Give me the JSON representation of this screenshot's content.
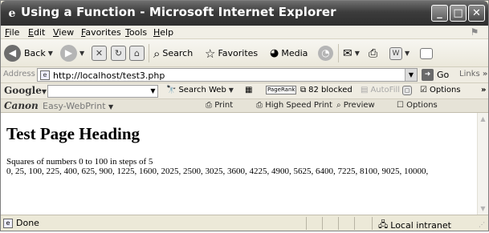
{
  "window": {
    "title": "Using a Function - Microsoft Internet Explorer",
    "controls": {
      "minimize": "_",
      "maximize": "□",
      "close": "✕"
    }
  },
  "menu": [
    "File",
    "Edit",
    "View",
    "Favorites",
    "Tools",
    "Help"
  ],
  "toolbar": {
    "back": "Back",
    "search": "Search",
    "favorites": "Favorites",
    "media": "Media"
  },
  "address": {
    "label": "Address",
    "url": "http://localhost/test3.php",
    "go": "Go",
    "links": "Links"
  },
  "google": {
    "logo": "Google",
    "search_web": "Search Web",
    "pagerank": "PageRank",
    "blocked": "82 blocked",
    "autofill": "AutoFill",
    "options": "Options"
  },
  "canon": {
    "logo": "Canon",
    "product": "Easy-WebPrint",
    "print": "Print",
    "high_speed": "High Speed Print",
    "preview": "Preview",
    "options": "Options"
  },
  "page": {
    "heading": "Test Page Heading",
    "subtitle": "Squares of numbers 0 to 100 in steps of 5",
    "values": "0, 25, 100, 225, 400, 625, 900, 1225, 1600, 2025, 2500, 3025, 3600, 4225, 4900, 5625, 6400, 7225, 8100, 9025, 10000,"
  },
  "status": {
    "text": "Done",
    "zone": "Local intranet"
  }
}
